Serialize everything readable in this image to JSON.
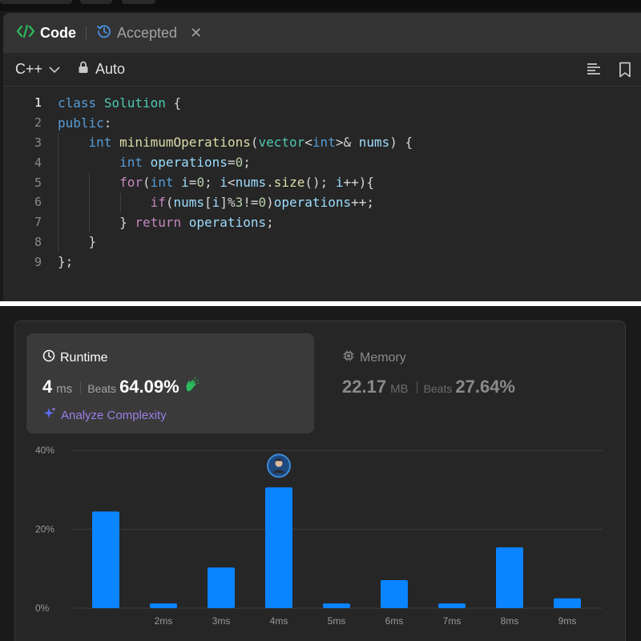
{
  "editor": {
    "tab_code": "Code",
    "tab_accepted": "Accepted",
    "language": "C++",
    "mode": "Auto",
    "lines": [
      {
        "num": "1"
      },
      {
        "num": "2"
      },
      {
        "num": "3"
      },
      {
        "num": "4"
      },
      {
        "num": "5"
      },
      {
        "num": "6"
      },
      {
        "num": "7"
      },
      {
        "num": "8"
      },
      {
        "num": "9"
      }
    ]
  },
  "result": {
    "runtime": {
      "title": "Runtime",
      "value": "4",
      "unit": "ms",
      "beats_label": "Beats",
      "beats": "64.09%"
    },
    "memory": {
      "title": "Memory",
      "value": "22.17",
      "unit": "MB",
      "beats_label": "Beats",
      "beats": "27.64%"
    },
    "analyze_label": "Analyze Complexity"
  },
  "colors": {
    "bar": "#0a84ff",
    "accent_green": "#2cbb5d",
    "purple": "#9b7fe6"
  },
  "chart_data": {
    "type": "bar",
    "categories": [
      "",
      "2ms",
      "3ms",
      "4ms",
      "5ms",
      "6ms",
      "7ms",
      "8ms",
      "9ms"
    ],
    "values": [
      24.5,
      1.2,
      10.3,
      30.6,
      1.2,
      7.1,
      1.2,
      15.4,
      2.5
    ],
    "y_ticks": [
      "0%",
      "20%",
      "40%"
    ],
    "ylim": [
      0,
      40
    ],
    "highlight_category": "4ms",
    "grid": true
  }
}
